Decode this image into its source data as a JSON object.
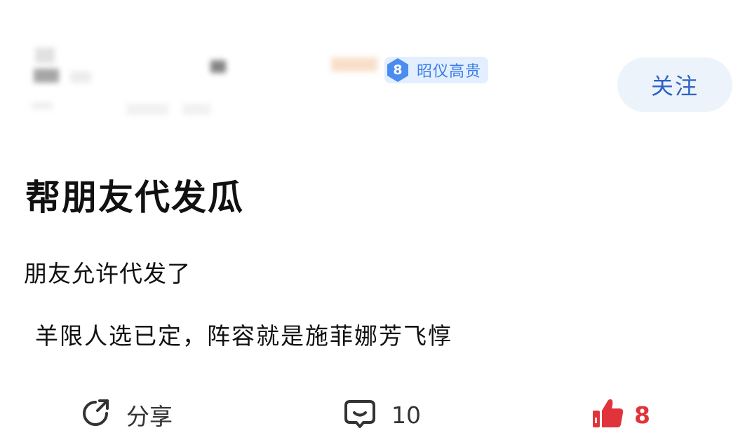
{
  "header": {
    "level_badge": {
      "number": "8",
      "title": "昭仪高贵"
    },
    "follow_label": "关注"
  },
  "post": {
    "title": "帮朋友代发瓜",
    "body_line1": "朋友允许代发了",
    "body_line2": "羊限人选已定，阵容就是施菲娜芳飞惇"
  },
  "actions": {
    "share_label": "分享",
    "comment_count": "10",
    "like_count": "8"
  },
  "colors": {
    "accent_blue": "#2f63c5",
    "badge_blue": "#4a8cf0",
    "like_red": "#e0343a"
  },
  "icons": [
    "share-icon",
    "comment-icon",
    "thumbs-up-icon",
    "level-diamond-icon"
  ]
}
